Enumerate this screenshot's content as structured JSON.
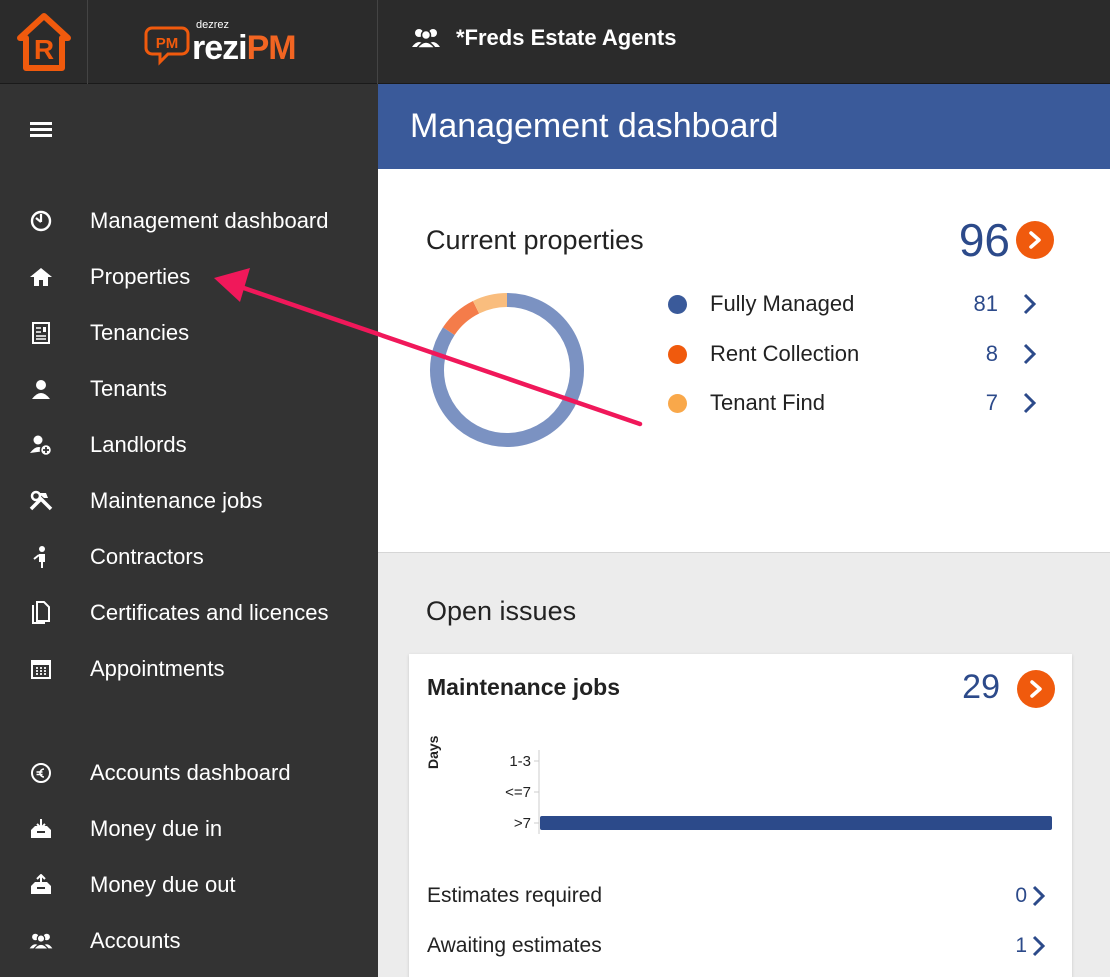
{
  "brand": {
    "small": "dezrez",
    "big_prefix": "rezi",
    "big_suffix": "PM",
    "badge": "PM"
  },
  "agency": {
    "name": "*Freds Estate Agents",
    "icon": "group-icon"
  },
  "sidebar": {
    "items": [
      {
        "label": "Management dashboard",
        "icon": "dashboard-icon"
      },
      {
        "label": "Properties",
        "icon": "home-icon"
      },
      {
        "label": "Tenancies",
        "icon": "contract-icon"
      },
      {
        "label": "Tenants",
        "icon": "user-icon"
      },
      {
        "label": "Landlords",
        "icon": "landlord-icon"
      },
      {
        "label": "Maintenance jobs",
        "icon": "tools-icon"
      },
      {
        "label": "Contractors",
        "icon": "worker-icon"
      },
      {
        "label": "Certificates and licences",
        "icon": "documents-icon"
      },
      {
        "label": "Appointments",
        "icon": "calendar-icon"
      },
      {
        "label": "Accounts dashboard",
        "icon": "euro-icon"
      },
      {
        "label": "Money due in",
        "icon": "inbox-in-icon"
      },
      {
        "label": "Money due out",
        "icon": "inbox-out-icon"
      },
      {
        "label": "Accounts",
        "icon": "group-icon"
      }
    ]
  },
  "header": {
    "title": "Management dashboard"
  },
  "current_properties": {
    "title": "Current properties",
    "total": "96",
    "legend": [
      {
        "name": "Fully Managed",
        "value": "81",
        "color": "#3a5a9a"
      },
      {
        "name": "Rent Collection",
        "value": "8",
        "color": "#f05a0d"
      },
      {
        "name": "Tenant Find",
        "value": "7",
        "color": "#f9a84a"
      }
    ]
  },
  "open_issues": {
    "title": "Open issues",
    "maintenance": {
      "title": "Maintenance jobs",
      "count": "29",
      "rows": [
        {
          "label": "Estimates required",
          "value": "0"
        },
        {
          "label": "Awaiting estimates",
          "value": "1"
        }
      ]
    }
  },
  "chart_data": [
    {
      "type": "pie",
      "categories": [
        "Fully Managed",
        "Rent Collection",
        "Tenant Find"
      ],
      "values": [
        81,
        8,
        7
      ],
      "colors": [
        "#7b92c2",
        "#f47c4a",
        "#f9bd7e"
      ],
      "title": "",
      "donut": true
    },
    {
      "type": "bar",
      "orientation": "horizontal",
      "categories": [
        "1-3",
        "<=7",
        ">7"
      ],
      "values": [
        0,
        0,
        29
      ],
      "ylabel": "Days",
      "xlabel": "",
      "color": "#2c4a8a"
    }
  ]
}
